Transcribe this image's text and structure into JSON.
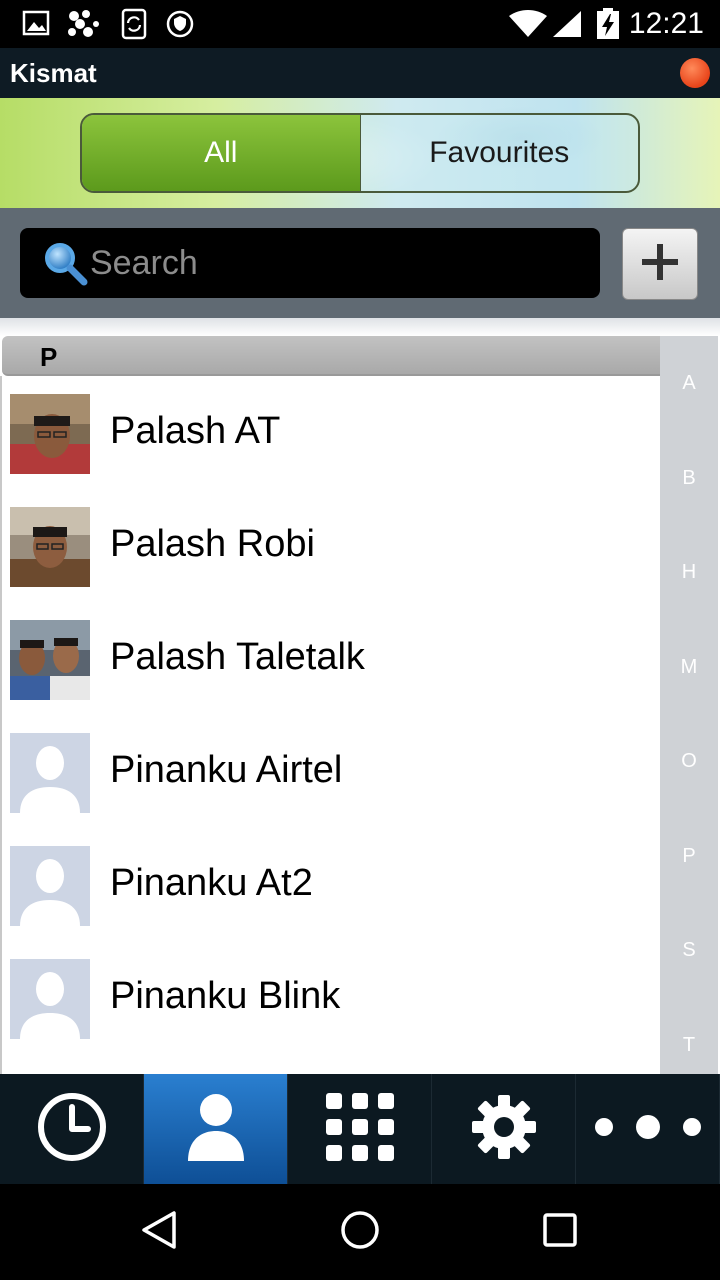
{
  "status_bar": {
    "time": "12:21",
    "left_icons": [
      "image-icon",
      "kismat-app-icon",
      "sync-icon",
      "vpn-shield-icon"
    ],
    "right_icons": [
      "wifi-icon",
      "signal-icon",
      "battery-charging-icon"
    ]
  },
  "app": {
    "title": "Kismat",
    "status_dot_color": "#e8441a"
  },
  "segments": {
    "all_label": "All",
    "favourites_label": "Favourites",
    "active": "All"
  },
  "search": {
    "placeholder": "Search",
    "value": ""
  },
  "add_button_icon": "plus-icon",
  "list": {
    "section_letter": "P",
    "contacts": [
      {
        "name": "Palash AT",
        "avatar": "photo"
      },
      {
        "name": "Palash Robi",
        "avatar": "photo"
      },
      {
        "name": "Palash Taletalk",
        "avatar": "group-photo"
      },
      {
        "name": "Pinanku Airtel",
        "avatar": "placeholder"
      },
      {
        "name": "Pinanku At2",
        "avatar": "placeholder"
      },
      {
        "name": "Pinanku Blink",
        "avatar": "placeholder"
      }
    ]
  },
  "alpha_index": [
    "A",
    "B",
    "H",
    "M",
    "O",
    "P",
    "S",
    "T"
  ],
  "tabs": [
    {
      "name": "recents",
      "icon": "clock-icon",
      "active": false
    },
    {
      "name": "contacts",
      "icon": "person-icon",
      "active": true
    },
    {
      "name": "dialpad",
      "icon": "dialpad-icon",
      "active": false
    },
    {
      "name": "settings",
      "icon": "gear-icon",
      "active": false
    },
    {
      "name": "more",
      "icon": "more-dots-icon",
      "active": false
    }
  ],
  "nav": [
    "back-icon",
    "home-icon",
    "recents-icon"
  ]
}
